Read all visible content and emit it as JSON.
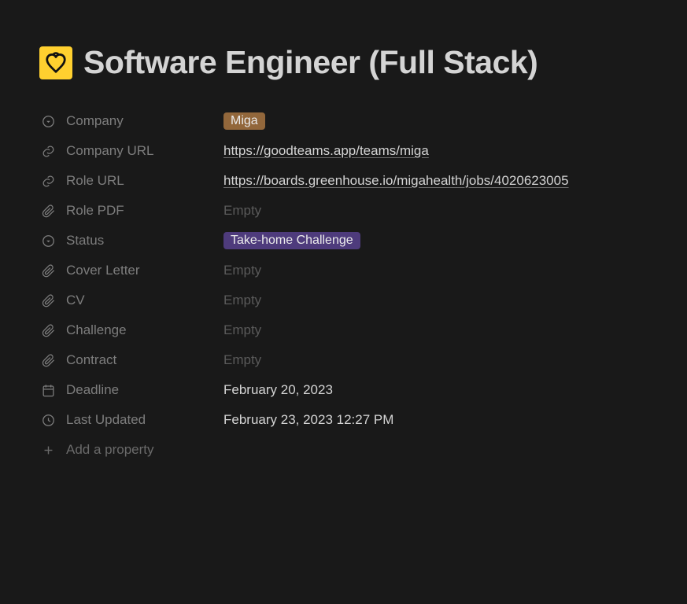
{
  "page": {
    "title": "Software Engineer (Full Stack)"
  },
  "properties": {
    "company": {
      "label": "Company",
      "value": "Miga"
    },
    "company_url": {
      "label": "Company URL",
      "value": "https://goodteams.app/teams/miga"
    },
    "role_url": {
      "label": "Role URL",
      "value": "https://boards.greenhouse.io/migahealth/jobs/4020623005"
    },
    "role_pdf": {
      "label": "Role PDF",
      "value": "Empty"
    },
    "status": {
      "label": "Status",
      "value": "Take-home Challenge"
    },
    "cover_letter": {
      "label": "Cover Letter",
      "value": "Empty"
    },
    "cv": {
      "label": "CV",
      "value": "Empty"
    },
    "challenge": {
      "label": "Challenge",
      "value": "Empty"
    },
    "contract": {
      "label": "Contract",
      "value": "Empty"
    },
    "deadline": {
      "label": "Deadline",
      "value": "February 20, 2023"
    },
    "last_updated": {
      "label": "Last Updated",
      "value": "February 23, 2023 12:27 PM"
    }
  },
  "actions": {
    "add_property": "Add a property"
  }
}
